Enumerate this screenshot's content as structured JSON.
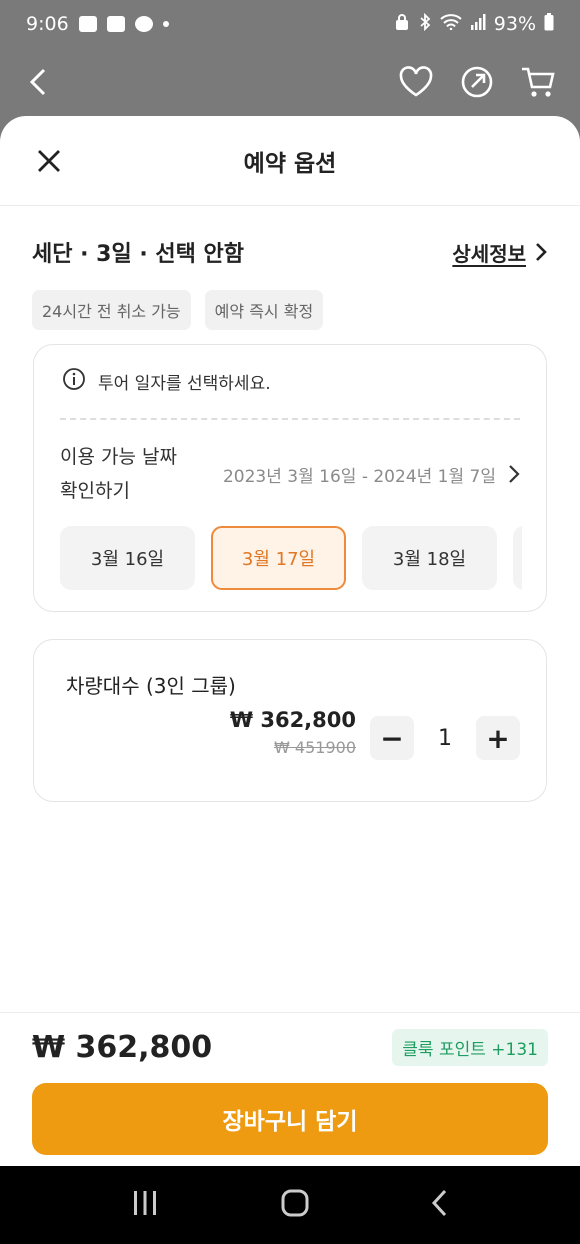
{
  "status_bar": {
    "time": "9:06",
    "battery": "93%"
  },
  "sheet": {
    "title": "예약 옵션"
  },
  "product": {
    "name": "세단 · 3일 · 선택 안함",
    "detail_link": "상세정보",
    "tags": [
      "24시간 전 취소 가능",
      "예약 즉시 확정"
    ]
  },
  "date_selection": {
    "info_text": "투어 일자를 선택하세요.",
    "avail_label": "이용 가능 날짜 확인하기",
    "range": "2023년 3월 16일 - 2024년 1월 7일",
    "chips": [
      {
        "label": "3월 16일"
      },
      {
        "label": "3월 17일"
      },
      {
        "label": "3월 18일"
      }
    ],
    "selected_index": 1
  },
  "quantity": {
    "title": "차량대수 (3인 그룹)",
    "price": "₩ 362,800",
    "original_price": "₩ 451900",
    "value": "1",
    "minus": "−",
    "plus": "+"
  },
  "footer": {
    "total": "₩ 362,800",
    "points": "클룩 포인트 +131",
    "cart_button": "장바구니 담기"
  },
  "colors": {
    "accent_orange": "#ee9b12",
    "selected_chip_border": "#ee8a3a",
    "points_green": "#1e9d60"
  }
}
